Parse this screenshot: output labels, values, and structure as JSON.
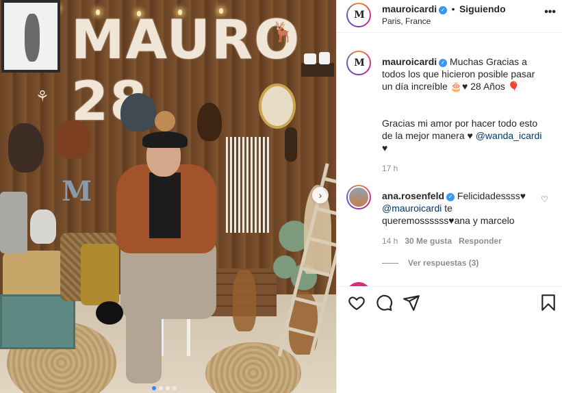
{
  "photo": {
    "sign_text": "MAURO 28",
    "wall_letter": "M",
    "next_arrow": "chevron-right-icon",
    "carousel_dots": 4,
    "carousel_active": 1
  },
  "post": {
    "username": "mauroicardi",
    "separator": "•",
    "follow_status": "Siguiendo",
    "location": "Paris, France",
    "more_icon": "more-horizontal-icon",
    "avatar_text": "M"
  },
  "caption": {
    "username": "mauroicardi",
    "line1": "Muchas Gracias a todos los que hicieron posible pasar un día increíble 🎂♥ 28 Años 🎈",
    "line2_prefix": "Gracias mi amor por hacer todo esto de la mejor manera ♥ ",
    "mention": "@wanda_icardi",
    "line2_suffix": "♥",
    "time": "17 h"
  },
  "comment": {
    "username": "ana.rosenfeld",
    "text_prefix": "Felicidadessss♥ ",
    "mention": "@mauroicardi",
    "text_suffix": " te queremossssss♥ana y marcelo",
    "time": "14 h",
    "likes": "30 Me gusta",
    "reply_label": "Responder",
    "view_replies": "Ver respuestas (3)"
  },
  "actions": {
    "like": "heart-icon",
    "comment": "comment-icon",
    "share": "send-icon",
    "save": "bookmark-icon"
  },
  "colors": {
    "verified": "#3897f0",
    "link": "#00376b",
    "muted": "#8e8e8e",
    "carousel_active": "#2e87ff"
  }
}
